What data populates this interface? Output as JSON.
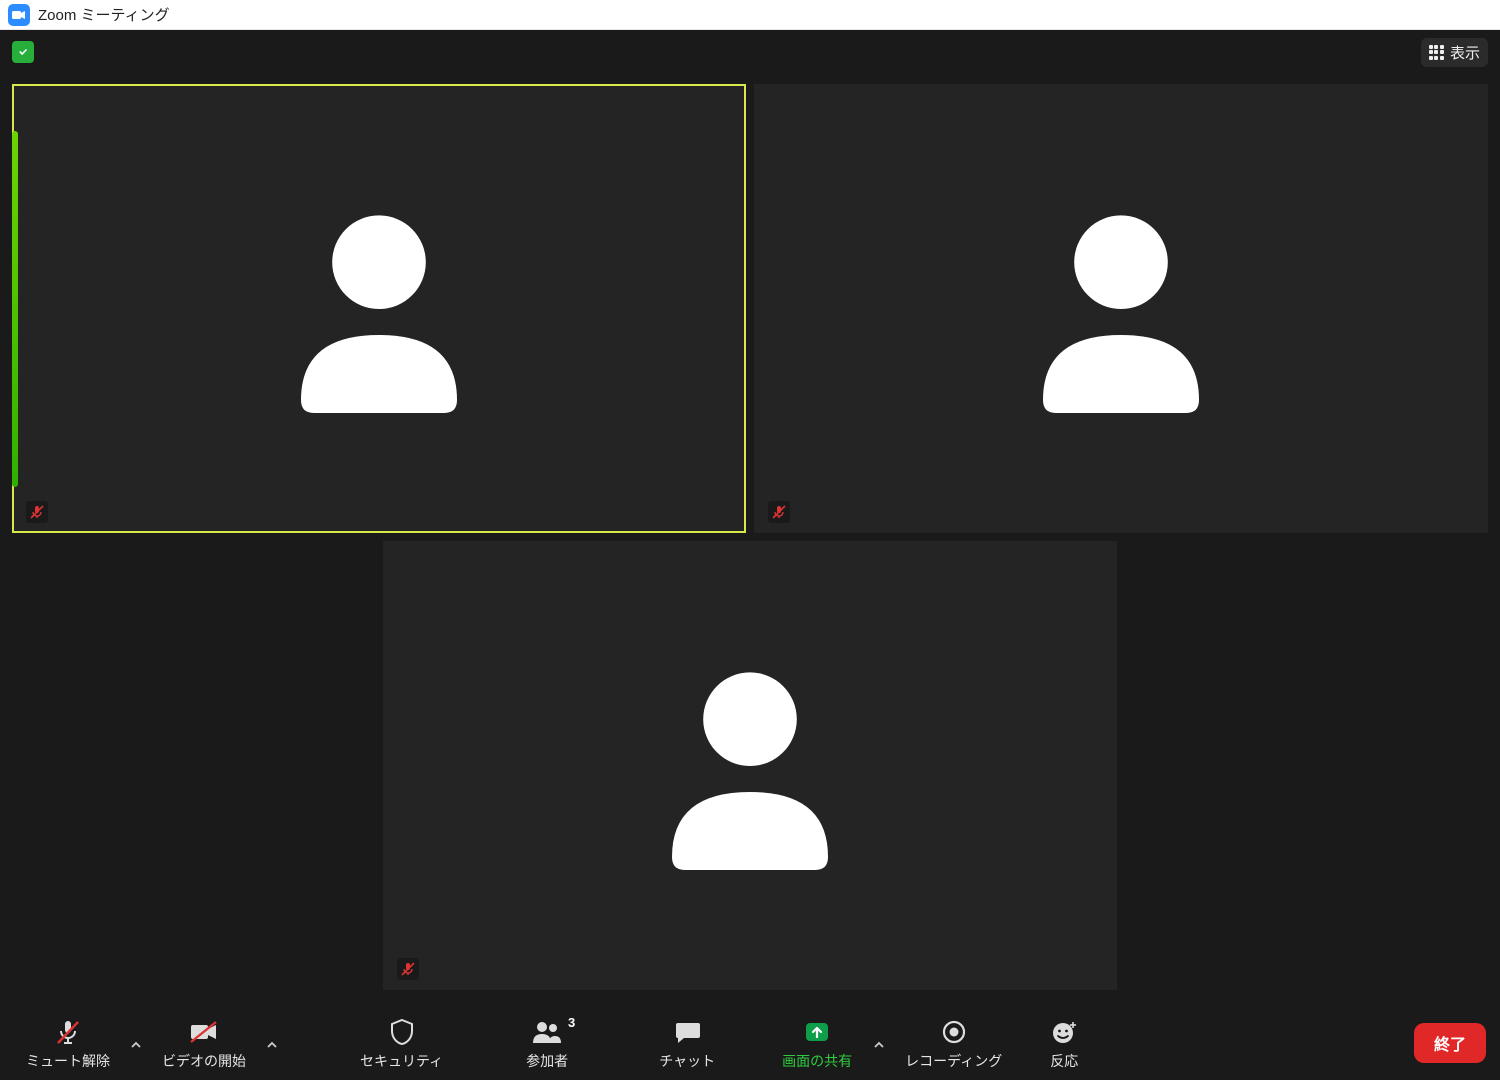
{
  "titlebar": {
    "title": "Zoom ミーティング"
  },
  "header": {
    "view_label": "表示"
  },
  "participants": [
    {
      "muted": true,
      "speaking": true
    },
    {
      "muted": true,
      "speaking": false
    },
    {
      "muted": true,
      "speaking": false
    }
  ],
  "toolbar": {
    "unmute": "ミュート解除",
    "start_video": "ビデオの開始",
    "security": "セキュリティ",
    "participants": "参加者",
    "participants_count": "3",
    "chat": "チャット",
    "share_screen": "画面の共有",
    "record": "レコーディング",
    "reactions": "反応",
    "end": "終了"
  }
}
